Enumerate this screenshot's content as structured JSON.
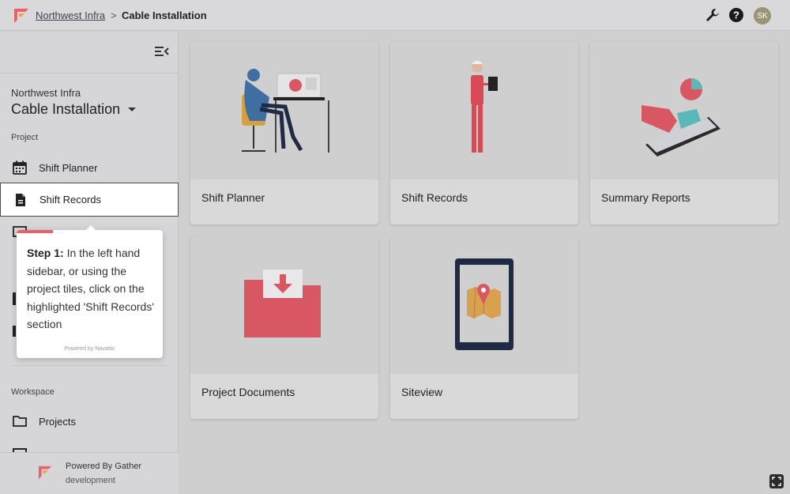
{
  "topbar": {
    "breadcrumb_org": "Northwest Infra",
    "breadcrumb_sep": ">",
    "breadcrumb_current": "Cable Installation",
    "avatar_initials": "SK",
    "icons": [
      "wrench-icon",
      "help-icon"
    ]
  },
  "sidebar": {
    "org_name": "Northwest Infra",
    "project_title": "Cable Installation",
    "project_section": "Project",
    "workspace_section": "Workspace",
    "items": [
      {
        "label": "Shift Planner",
        "icon": "calendar-icon"
      },
      {
        "label": "Shift Records",
        "icon": "document-icon",
        "active": true
      }
    ],
    "workspace_items": [
      {
        "label": "Projects",
        "icon": "folder-icon"
      }
    ],
    "footer_line1": "Powered By Gather",
    "footer_line2": "development"
  },
  "tooltip": {
    "step": "Step 1:",
    "text": " In the left hand sidebar, or using the project tiles, click on the highlighted 'Shift Records' section",
    "powered": "Powered by Navattic"
  },
  "tiles": [
    {
      "label": "Shift Planner"
    },
    {
      "label": "Shift Records"
    },
    {
      "label": "Summary Reports"
    },
    {
      "label": "Project Documents"
    },
    {
      "label": "Siteview"
    }
  ],
  "colors": {
    "accent": "#e8606a",
    "tile_red": "#d95763",
    "navy": "#1f2a44"
  }
}
